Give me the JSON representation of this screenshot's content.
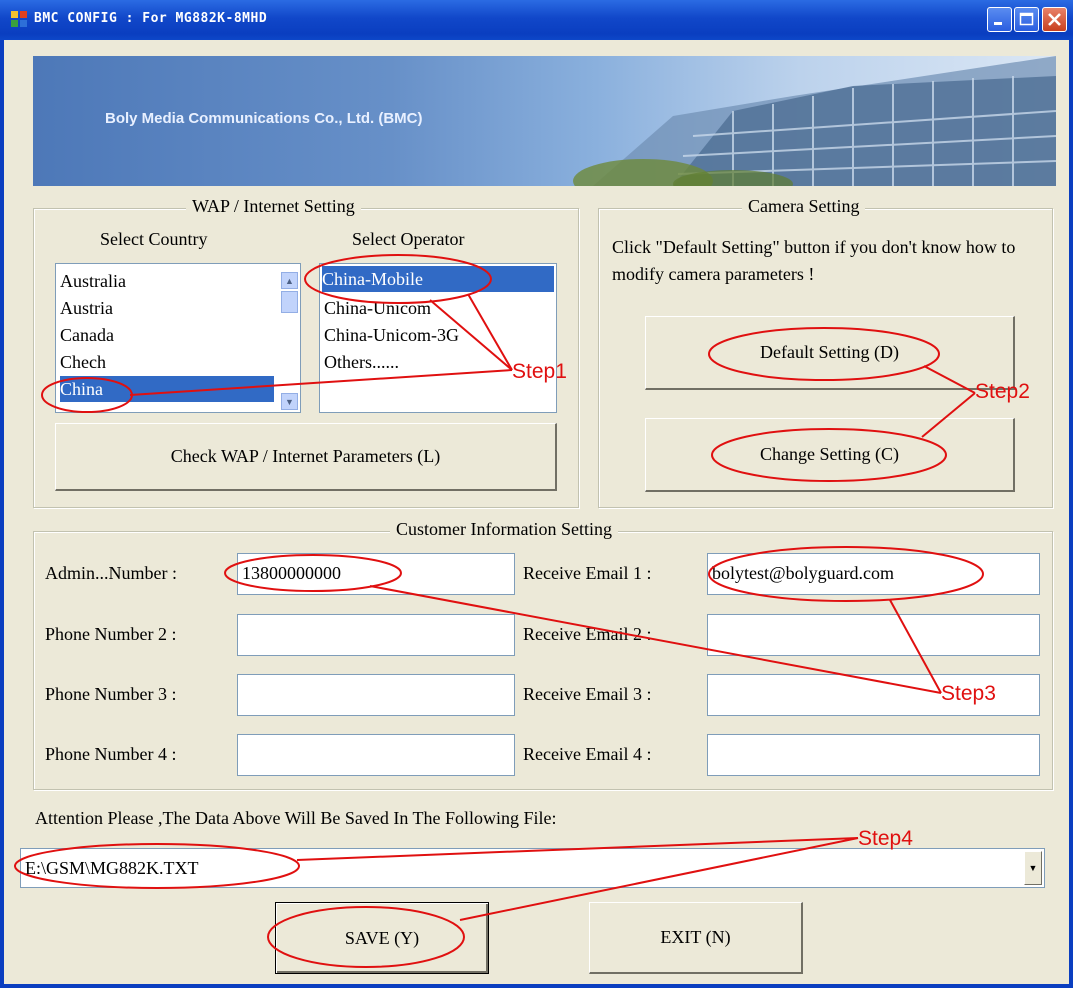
{
  "window": {
    "title": "BMC CONFIG : For MG882K-8MHD",
    "banner_text": "Boly Media Communications Co., Ltd. (BMC)"
  },
  "wap": {
    "group_title": "WAP / Internet Setting",
    "country_label": "Select Country",
    "operator_label": "Select Operator",
    "countries": [
      "Australia",
      "Austria",
      "Canada",
      "Chech",
      "China"
    ],
    "selected_country": "China",
    "operators": [
      "China-Mobile",
      "China-Unicom",
      "China-Unicom-3G",
      "Others......"
    ],
    "selected_operator": "China-Mobile",
    "check_button": "Check WAP / Internet Parameters (L)"
  },
  "camera": {
    "group_title": "Camera Setting",
    "hint": "Click \"Default Setting\" button if you don't know how to modify camera parameters !",
    "default_button": "Default Setting (D)",
    "change_button": "Change Setting (C)"
  },
  "customer": {
    "group_title": "Customer Information Setting",
    "phones": [
      {
        "label": "Admin...Number :",
        "value": "13800000000"
      },
      {
        "label": "Phone Number 2 :",
        "value": ""
      },
      {
        "label": "Phone Number 3 :",
        "value": ""
      },
      {
        "label": "Phone Number 4 :",
        "value": ""
      }
    ],
    "emails": [
      {
        "label": "Receive Email 1 :",
        "value": "bolytest@bolyguard.com"
      },
      {
        "label": "Receive Email 2 :",
        "value": ""
      },
      {
        "label": "Receive Email 3 :",
        "value": ""
      },
      {
        "label": "Receive Email 4 :",
        "value": ""
      }
    ]
  },
  "file": {
    "attention": "Attention Please ,The Data Above Will Be Saved In The Following  File:",
    "path": "E:\\GSM\\MG882K.TXT"
  },
  "actions": {
    "save": "SAVE (Y)",
    "exit": "EXIT (N)"
  },
  "annotations": {
    "step1": "Step1",
    "step2": "Step2",
    "step3": "Step3",
    "step4": "Step4"
  },
  "colors": {
    "annotation": "#e01010",
    "selection": "#316ac5",
    "titlebar": "#0a3ec0",
    "dialog_bg": "#ece9d8"
  }
}
